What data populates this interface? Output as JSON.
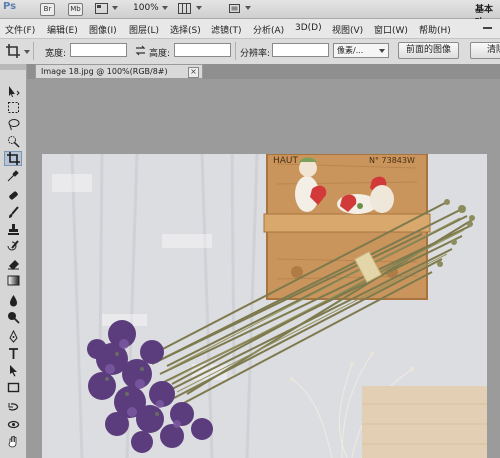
{
  "app": {
    "logo": "Ps",
    "bridge_btn": "Br",
    "minibridge_btn": "Mb",
    "zoom": "100%",
    "workspace": "基本功"
  },
  "menu": [
    "文件(F)",
    "编辑(E)",
    "图像(I)",
    "图层(L)",
    "选择(S)",
    "滤镜(T)",
    "分析(A)",
    "3D(D)",
    "视图(V)",
    "窗口(W)",
    "帮助(H)"
  ],
  "options": {
    "width_label": "宽度:",
    "width_value": "",
    "height_label": "高度:",
    "height_value": "",
    "resolution_label": "分辨率:",
    "resolution_value": "",
    "unit": "像素/...",
    "front_image": "前面的图像",
    "clear": "清除"
  },
  "document": {
    "tab_title": "Image 18.jpg @ 100%(RGB/8#)",
    "close": "×"
  },
  "photo": {
    "sign_text_left": "HAUT",
    "sign_text_right": "N° 73843W"
  },
  "colors": {
    "accent": "#5a7fb0",
    "active_tool": "#b7c4d6",
    "wall": "#dcdde1",
    "shelf": "#c9955c",
    "flowers": "#5b3c7d"
  },
  "tools": [
    "move-icon",
    "marquee-icon",
    "lasso-icon",
    "quick-select-icon",
    "crop-icon",
    "eyedropper-icon",
    "spot-heal-icon",
    "brush-icon",
    "stamp-icon",
    "history-brush-icon",
    "eraser-icon",
    "gradient-icon",
    "blur-icon",
    "dodge-icon",
    "pen-icon",
    "type-icon",
    "path-select-icon",
    "shape-icon",
    "3d-rotate-icon",
    "3d-orbit-icon",
    "hand-icon"
  ]
}
